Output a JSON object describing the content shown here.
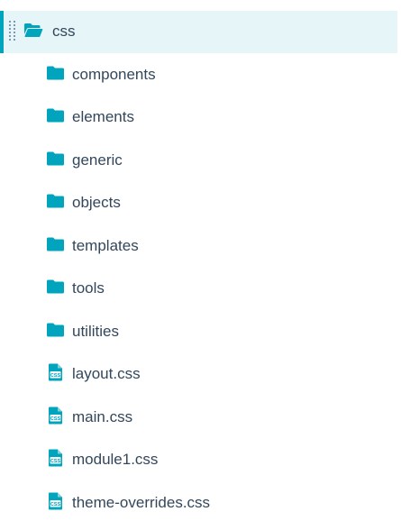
{
  "colors": {
    "accent": "#00a4bd",
    "selected_bg": "#e5f5f8",
    "text": "#33475b",
    "handle": "#7c98b6"
  },
  "root": {
    "label": "css",
    "icon": "folder-open-icon",
    "selected": true
  },
  "items": [
    {
      "label": "components",
      "type": "folder",
      "icon": "folder-icon"
    },
    {
      "label": "elements",
      "type": "folder",
      "icon": "folder-icon"
    },
    {
      "label": "generic",
      "type": "folder",
      "icon": "folder-icon"
    },
    {
      "label": "objects",
      "type": "folder",
      "icon": "folder-icon"
    },
    {
      "label": "templates",
      "type": "folder",
      "icon": "folder-icon"
    },
    {
      "label": "tools",
      "type": "folder",
      "icon": "folder-icon"
    },
    {
      "label": "utilities",
      "type": "folder",
      "icon": "folder-icon"
    },
    {
      "label": "layout.css",
      "type": "file",
      "icon": "css-file-icon"
    },
    {
      "label": "main.css",
      "type": "file",
      "icon": "css-file-icon"
    },
    {
      "label": "module1.css",
      "type": "file",
      "icon": "css-file-icon"
    },
    {
      "label": "theme-overrides.css",
      "type": "file",
      "icon": "css-file-icon"
    }
  ]
}
